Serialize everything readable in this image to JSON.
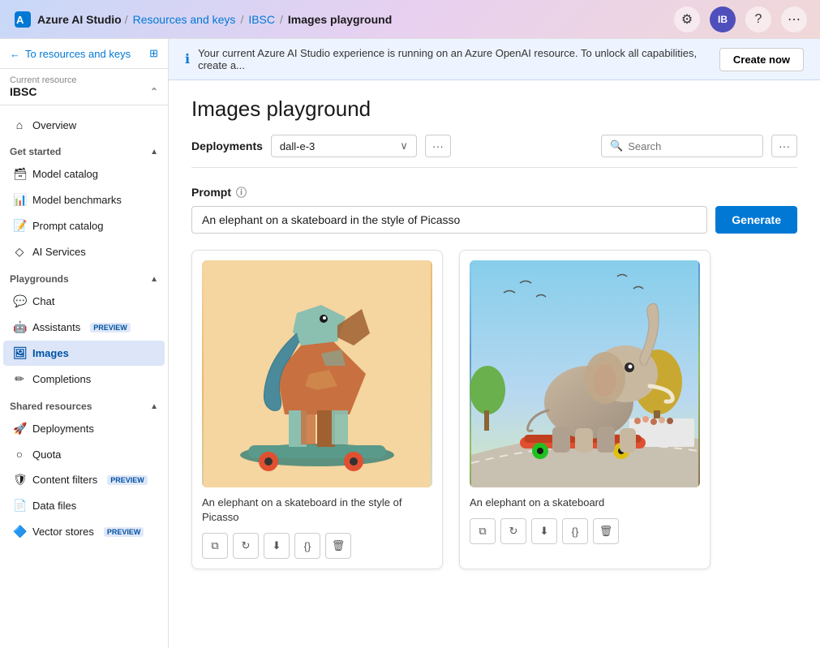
{
  "app": {
    "name": "Azure AI Studio",
    "logo_icon": "azure-icon"
  },
  "breadcrumb": {
    "items": [
      "Resources and keys",
      "IBSC",
      "Images playground"
    ]
  },
  "nav_actions": {
    "settings_icon": "⚙",
    "avatar_initials": "IB",
    "help_icon": "?",
    "more_icon": "⋯"
  },
  "sidebar": {
    "back_label": "To resources and keys",
    "resource_label": "Current resource",
    "resource_name": "IBSC",
    "overview": "Overview",
    "sections": [
      {
        "id": "get-started",
        "label": "Get started",
        "items": [
          {
            "id": "model-catalog",
            "label": "Model catalog",
            "icon": "🗃"
          },
          {
            "id": "model-benchmarks",
            "label": "Model benchmarks",
            "icon": "📊"
          },
          {
            "id": "prompt-catalog",
            "label": "Prompt catalog",
            "icon": "📝"
          },
          {
            "id": "ai-services",
            "label": "AI Services",
            "icon": "◇"
          }
        ]
      },
      {
        "id": "playgrounds",
        "label": "Playgrounds",
        "items": [
          {
            "id": "chat",
            "label": "Chat",
            "icon": "💬"
          },
          {
            "id": "assistants",
            "label": "Assistants",
            "icon": "🤖",
            "badge": "PREVIEW"
          },
          {
            "id": "images",
            "label": "Images",
            "icon": "🖼",
            "active": true
          },
          {
            "id": "completions",
            "label": "Completions",
            "icon": "✏"
          }
        ]
      },
      {
        "id": "shared-resources",
        "label": "Shared resources",
        "items": [
          {
            "id": "deployments",
            "label": "Deployments",
            "icon": "🚀"
          },
          {
            "id": "quota",
            "label": "Quota",
            "icon": "○"
          },
          {
            "id": "content-filters",
            "label": "Content filters",
            "icon": "🛡",
            "badge": "PREVIEW"
          },
          {
            "id": "data-files",
            "label": "Data files",
            "icon": "📄"
          },
          {
            "id": "vector-stores",
            "label": "Vector stores",
            "icon": "🔷",
            "badge": "PREVIEW"
          }
        ]
      }
    ]
  },
  "banner": {
    "text": "Your current Azure AI Studio experience is running on an Azure OpenAI resource. To unlock all capabilities, create a...",
    "button_label": "Create now"
  },
  "page": {
    "title": "Images playground"
  },
  "toolbar": {
    "deployments_label": "Deployments",
    "selected_deployment": "dall-e-3",
    "search_placeholder": "Search",
    "search_icon": "🔍"
  },
  "prompt": {
    "label": "Prompt",
    "value": "An elephant on a skateboard in the style of Picasso",
    "generate_btn": "Generate"
  },
  "images": [
    {
      "id": "image-1",
      "caption": "An elephant on a skateboard in the style of Picasso",
      "style": "cubist"
    },
    {
      "id": "image-2",
      "caption": "An elephant on a skateboard",
      "style": "realistic"
    }
  ],
  "image_actions": [
    "copy",
    "refresh",
    "download",
    "code",
    "delete"
  ]
}
